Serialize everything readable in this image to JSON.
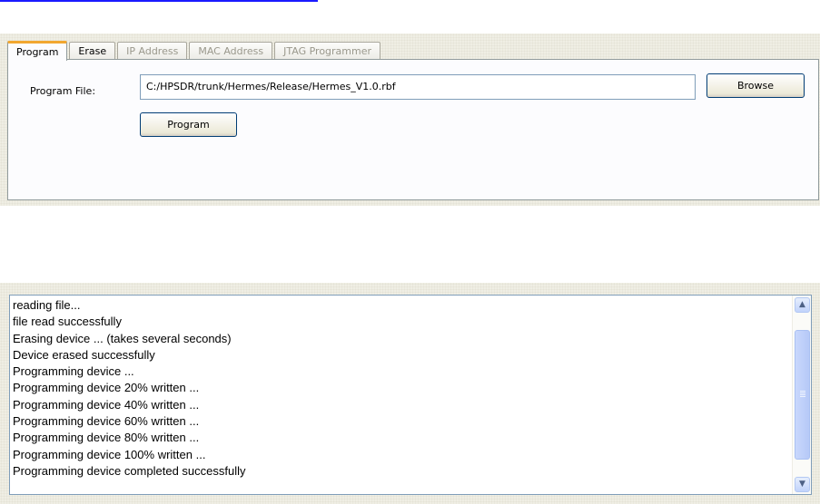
{
  "tabs": [
    {
      "label": "Program",
      "state": "active"
    },
    {
      "label": "Erase",
      "state": "enabled"
    },
    {
      "label": "IP Address",
      "state": "disabled"
    },
    {
      "label": "MAC Address",
      "state": "disabled"
    },
    {
      "label": "JTAG Programmer",
      "state": "disabled"
    }
  ],
  "program_tab": {
    "file_label": "Program File:",
    "file_value": "C:/HPSDR/trunk/Hermes/Release/Hermes_V1.0.rbf",
    "browse_label": "Browse",
    "program_label": "Program"
  },
  "log": {
    "lines": [
      "reading file...",
      "file read successfully",
      "Erasing device ... (takes several seconds)",
      "Device erased successfully",
      "Programming device ...",
      "Programming device 20% written ...",
      "Programming device 40% written ...",
      "Programming device 60% written ...",
      "Programming device 80% written ...",
      "Programming device 100% written ...",
      "Programming device completed successfully"
    ],
    "scroll_up_icon": "▲",
    "scroll_down_icon": "▼"
  },
  "colors": {
    "active_tab_accent": "#f2a730",
    "panel_background": "#efeee4",
    "scrollbar_accent": "#c1d3fb"
  }
}
